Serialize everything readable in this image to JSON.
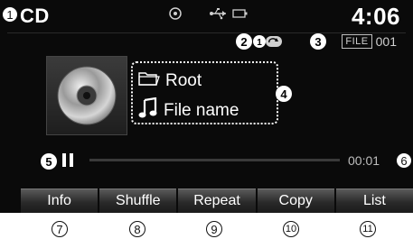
{
  "header": {
    "source": "CD",
    "clock": "4:06",
    "icons": [
      "disc-status-icon",
      "usb-icon",
      "battery-icon"
    ]
  },
  "track": {
    "folder_icon": "folder-icon",
    "folder": "Root",
    "music_icon": "music-note-icon",
    "file_name": "File name",
    "file_label": "FILE",
    "file_number": "001"
  },
  "playback": {
    "state_icon": "pause-icon",
    "elapsed": "00:01"
  },
  "buttons": [
    {
      "label": "Info"
    },
    {
      "label": "Shuffle"
    },
    {
      "label": "Repeat"
    },
    {
      "label": "Copy"
    },
    {
      "label": "List"
    }
  ],
  "callouts": {
    "c1": "1",
    "c2": "2",
    "c3": "3",
    "c4": "4",
    "c5": "5",
    "c6": "6",
    "c7": "7",
    "c8": "8",
    "c9": "9",
    "c10": "10",
    "c11": "11"
  },
  "colors": {
    "screen_bg": "#0a0a0a",
    "text": "#ffffff",
    "button_top": "#5a5a5a",
    "button_bottom": "#1b1b1b"
  }
}
